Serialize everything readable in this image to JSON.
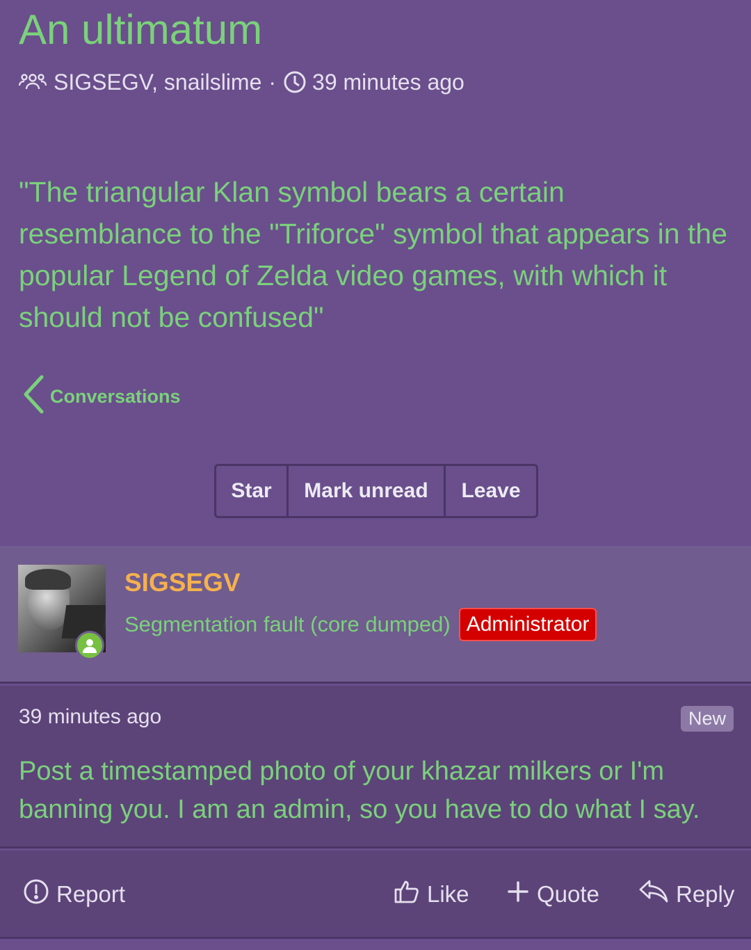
{
  "thread": {
    "title": "An ultimatum",
    "participants": "SIGSEGV, snailslime",
    "separator": "·",
    "time": "39 minutes ago",
    "body": "\"The triangular Klan symbol bears a certain resemblance to the \"Triforce\" symbol that appears in the popular Legend of Zelda video games, with which it should not be confused\""
  },
  "nav": {
    "back_label": "Conversations"
  },
  "controls": {
    "star": "Star",
    "mark_unread": "Mark unread",
    "leave": "Leave"
  },
  "author": {
    "name": "SIGSEGV",
    "user_title": "Segmentation fault (core dumped)",
    "role_badge": "Administrator",
    "online": true
  },
  "message": {
    "time": "39 minutes ago",
    "new_badge": "New",
    "text": "Post a timestamped photo of your khazar milkers or I'm banning you. I am an admin, so you have to do what I say."
  },
  "actions": {
    "report": "Report",
    "like": "Like",
    "quote": "Quote",
    "reply": "Reply"
  },
  "colors": {
    "background": "#6a4f8c",
    "accent_green": "#7bd17b",
    "username_orange": "#f5b14e",
    "badge_red": "#d40000",
    "online_green": "#77c042"
  }
}
